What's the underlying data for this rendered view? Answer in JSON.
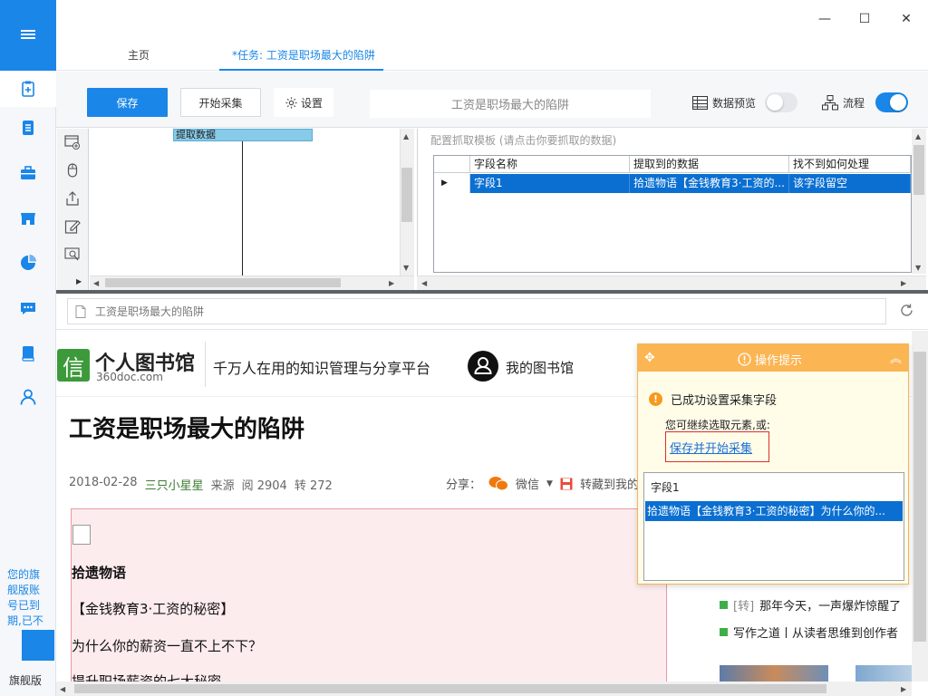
{
  "window": {
    "minimize": "—",
    "maximize": "☐",
    "close": "✕"
  },
  "tabs": [
    {
      "label": "主页"
    },
    {
      "label": "*任务: 工资是职场最大的陷阱"
    }
  ],
  "toolbar": {
    "save_label": "保存",
    "start_label": "开始采集",
    "settings_label": "设置",
    "task_title": "工资是职场最大的陷阱",
    "data_preview_label": "数据预览",
    "flow_label": "流程"
  },
  "sidebar": {
    "expire_notice": "您的旗舰版账号已到期,已不",
    "edition": "旗舰版"
  },
  "workflow": {
    "node_label": "提取数据"
  },
  "template": {
    "hint": "配置抓取模板 (请点击你要抓取的数据)",
    "columns": [
      "字段名称",
      "提取到的数据",
      "找不到如何处理"
    ],
    "row": {
      "marker": "▶",
      "field": "字段1",
      "data": "拾遗物语【金钱教育3·工资的...",
      "fallback": "该字段留空"
    }
  },
  "browser": {
    "address": "工资是职场最大的陷阱"
  },
  "webpage": {
    "logo_char": "信",
    "logo_name": "个人图书馆",
    "logo_domain": "360doc.com",
    "slogan": "千万人在用的知识管理与分享平台",
    "my_library": "我的图书馆",
    "title": "工资是职场最大的陷阱",
    "meta": {
      "date": "2018-02-28",
      "author": "三只小星星",
      "source_label": "来源",
      "reads": "阅 2904",
      "shares": "转 272"
    },
    "share": {
      "label": "分享：",
      "wechat": "微信",
      "save_to": "转藏到我的图"
    },
    "paragraphs": [
      "拾遗物语",
      "【金钱教育3·工资的秘密】",
      "为什么你的薪资一直不上不下？",
      "提升职场薪资的七大秘密"
    ],
    "news": [
      {
        "tag": "[转]",
        "text": "那年今天，一声爆炸惊醒了"
      },
      {
        "tag": "",
        "text": "写作之道丨从读者思维到创作者"
      }
    ]
  },
  "tip": {
    "title": "操作提示",
    "success": "已成功设置采集字段",
    "continue": "您可继续选取元素,或:",
    "action": "保存并开始采集",
    "field": "字段1",
    "selected_value": "拾遗物语【金钱教育3·工资的秘密】为什么你的..."
  },
  "colors": {
    "accent": "#1a86e8",
    "tip_header": "#fbb553",
    "selection": "#0a6fd1"
  }
}
